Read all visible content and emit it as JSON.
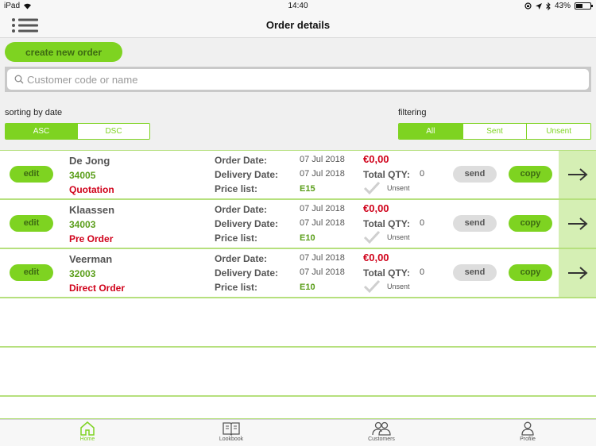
{
  "status_bar": {
    "device": "iPad",
    "time": "14:40",
    "battery": "43%"
  },
  "header": {
    "title": "Order details"
  },
  "toolbar": {
    "create_label": "create new order"
  },
  "search": {
    "placeholder": "Customer code or name",
    "value": ""
  },
  "sorting": {
    "label": "sorting by date",
    "options": [
      "ASC",
      "DSC"
    ],
    "selected": "ASC"
  },
  "filtering": {
    "label": "filtering",
    "options": [
      "All",
      "Sent",
      "Unsent"
    ],
    "selected": "All"
  },
  "labels": {
    "edit": "edit",
    "send": "send",
    "copy": "copy",
    "order_date": "Order Date:",
    "delivery_date": "Delivery Date:",
    "price_list": "Price list:",
    "total_qty": "Total QTY:"
  },
  "orders": [
    {
      "name": "De Jong",
      "code": "34005",
      "type": "Quotation",
      "order_date": "07 Jul 2018",
      "delivery_date": "07 Jul 2018",
      "price_list": "E15",
      "price": "€0,00",
      "qty": "0",
      "status": "Unsent"
    },
    {
      "name": "Klaassen",
      "code": "34003",
      "type": "Pre Order",
      "order_date": "07 Jul 2018",
      "delivery_date": "07 Jul 2018",
      "price_list": "E10",
      "price": "€0,00",
      "qty": "0",
      "status": "Unsent"
    },
    {
      "name": "Veerman",
      "code": "32003",
      "type": "Direct Order",
      "order_date": "07 Jul 2018",
      "delivery_date": "07 Jul 2018",
      "price_list": "E10",
      "price": "€0,00",
      "qty": "0",
      "status": "Unsent"
    }
  ],
  "tabs": [
    {
      "label": "Home",
      "icon": "home-icon",
      "active": true
    },
    {
      "label": "Lookbook",
      "icon": "book-icon",
      "active": false
    },
    {
      "label": "Customers",
      "icon": "customers-icon",
      "active": false
    },
    {
      "label": "Profile",
      "icon": "profile-icon",
      "active": false
    }
  ],
  "colors": {
    "accent": "#7ed321",
    "accent_light": "#d5efb4",
    "danger": "#d0021b",
    "code_green": "#5a9e1a"
  }
}
